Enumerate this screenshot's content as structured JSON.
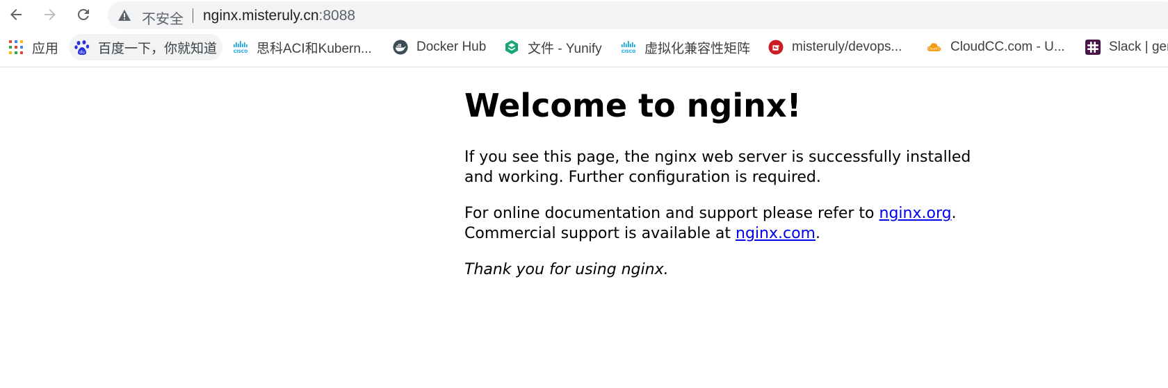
{
  "browser": {
    "omnibox": {
      "security_label": "不安全",
      "url_host": "nginx.misteruly.cn",
      "url_port": ":8088"
    },
    "bookmarks": [
      {
        "label": "应用",
        "icon": "apps-grid-icon"
      },
      {
        "label": "百度一下，你就知道",
        "icon": "baidu-paw-icon"
      },
      {
        "label": "思科ACI和Kubern...",
        "icon": "cisco-icon"
      },
      {
        "label": "Docker Hub",
        "icon": "docker-icon"
      },
      {
        "label": "文件 - Yunify",
        "icon": "yunify-icon"
      },
      {
        "label": "虚拟化兼容性矩阵",
        "icon": "cisco-icon"
      },
      {
        "label": "misteruly/devops...",
        "icon": "gitee-icon"
      },
      {
        "label": "CloudCC.com - U...",
        "icon": "cloudcc-icon"
      },
      {
        "label": "Slack | gen",
        "icon": "slack-icon"
      }
    ],
    "colors": {
      "omnibox_bg": "#f1f3f4",
      "link": "#0000ee",
      "cisco": "#049fd9",
      "gitee": "#c71d23",
      "cloudcc": "#f39c12",
      "slack": "#4a154b",
      "yunify": "#17a673"
    }
  },
  "page": {
    "heading": "Welcome to nginx!",
    "para1": "If you see this page, the nginx web server is successfully installed and working. Further configuration is required.",
    "para2_prefix": "For online documentation and support please refer to ",
    "para2_link": "nginx.org",
    "para2_suffix": ".",
    "para3_prefix": "Commercial support is available at ",
    "para3_link": "nginx.com",
    "para3_suffix": ".",
    "thanks": "Thank you for using nginx."
  }
}
